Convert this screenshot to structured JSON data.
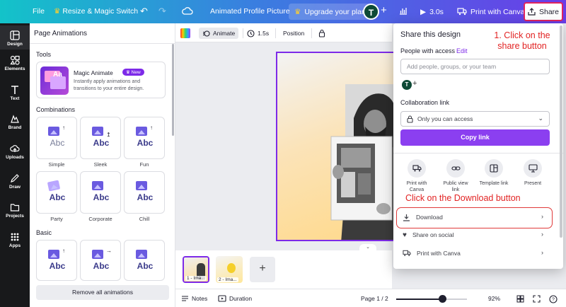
{
  "topbar": {
    "file": "File",
    "resize": "Resize & Magic Switch",
    "doc_title": "Animated Profile Picture",
    "upgrade": "Upgrade your plan",
    "avatar_initial": "T",
    "duration": "3.0s",
    "print": "Print with Canva",
    "share": "Share"
  },
  "rail": [
    "Design",
    "Elements",
    "Text",
    "Brand",
    "Uploads",
    "Draw",
    "Projects",
    "Apps"
  ],
  "panel": {
    "title": "Page Animations",
    "tools_heading": "Tools",
    "magic_name": "Magic Animate",
    "new_badge": "New",
    "magic_desc": "Instantly apply animations and transitions to your entire design.",
    "combinations_heading": "Combinations",
    "combinations": [
      "Simple",
      "Sleek",
      "Fun",
      "Party",
      "Corporate",
      "Chill"
    ],
    "basic_heading": "Basic",
    "tile_text": "Abc",
    "remove": "Remove all animations"
  },
  "canvas_toolbar": {
    "animate": "Animate",
    "timing": "1.5s",
    "position": "Position"
  },
  "thumbs": [
    "1 - Ima...",
    "2 - Ima..."
  ],
  "bottombar": {
    "notes": "Notes",
    "duration": "Duration",
    "page": "Page 1 / 2",
    "zoom": "92%"
  },
  "share": {
    "title": "Share this design",
    "people_label": "People with access",
    "edit": "Edit",
    "input_placeholder": "Add people, groups, or your team",
    "mini_avatar": "T",
    "collab_label": "Collaboration link",
    "access": "Only you can access",
    "copy_link": "Copy link",
    "options": [
      {
        "label": "Print with Canva",
        "icon": "truck-icon"
      },
      {
        "label": "Public view link",
        "icon": "link-icon"
      },
      {
        "label": "Template link",
        "icon": "template-icon"
      },
      {
        "label": "Present",
        "icon": "present-icon"
      }
    ],
    "download": "Download",
    "share_social": "Share on social",
    "print_canva": "Print with Canva"
  },
  "annotations": {
    "share_hint": "1. Click on the share button",
    "download_hint": "Click on the Download button"
  },
  "colors": {
    "accent": "#7d2ae8",
    "copy_btn": "#8b3ff0",
    "annotation": "#e22323"
  }
}
